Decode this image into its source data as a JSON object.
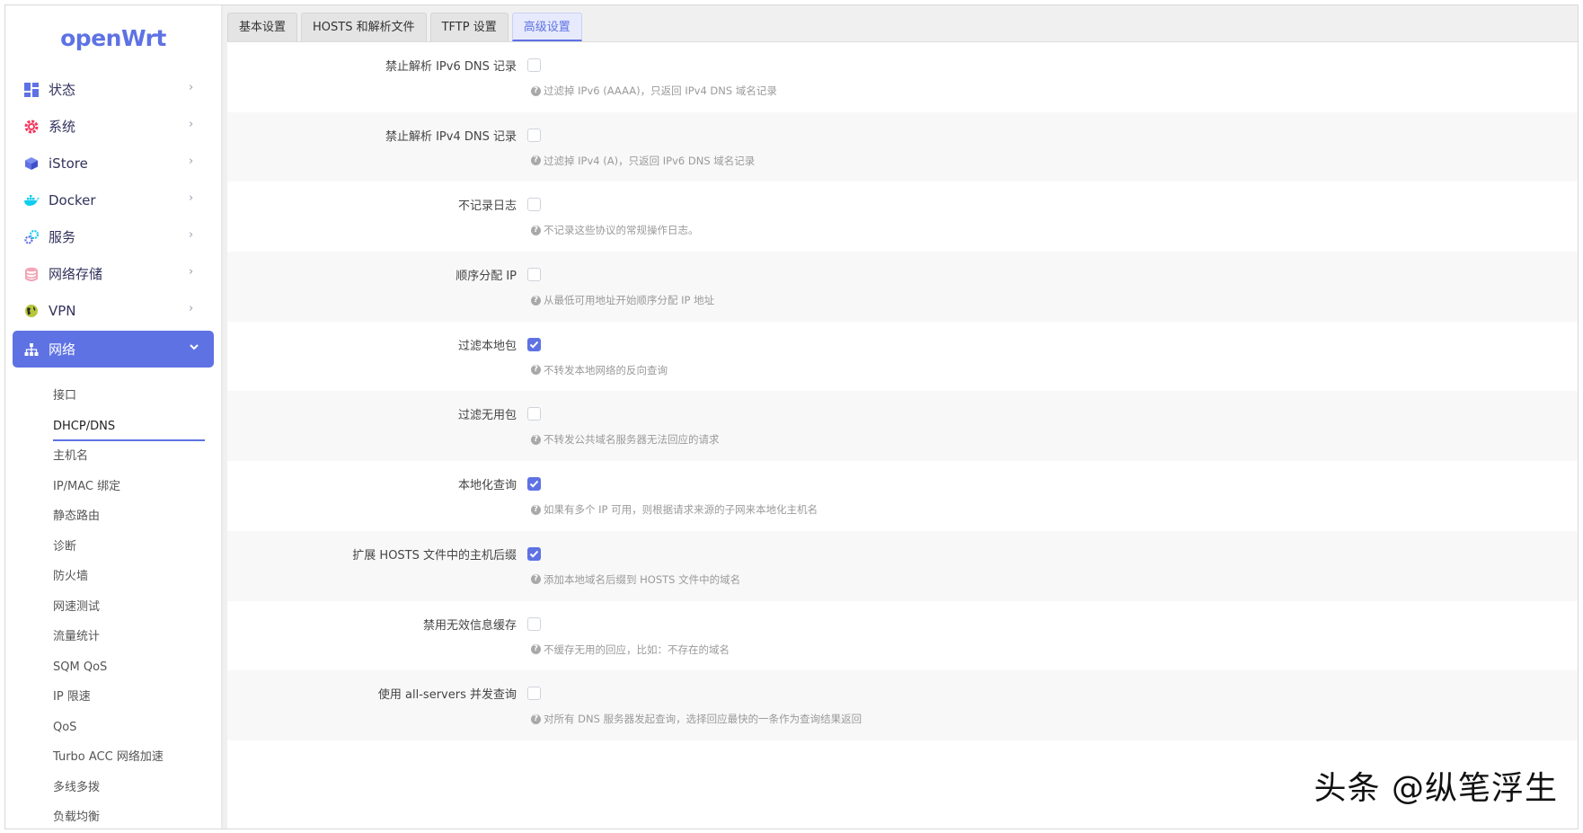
{
  "sidebar": {
    "logo": "openWrt",
    "menu": [
      {
        "label": "状态",
        "icon": "dashboard-icon"
      },
      {
        "label": "系统",
        "icon": "gear-icon"
      },
      {
        "label": "iStore",
        "icon": "cube-icon"
      },
      {
        "label": "Docker",
        "icon": "docker-whale-icon"
      },
      {
        "label": "服务",
        "icon": "services-icon"
      },
      {
        "label": "网络存储",
        "icon": "database-icon"
      },
      {
        "label": "VPN",
        "icon": "globe-icon"
      },
      {
        "label": "网络",
        "icon": "network-tree-icon",
        "expanded": true
      }
    ],
    "submenu": [
      {
        "label": "接口"
      },
      {
        "label": "DHCP/DNS",
        "current": true
      },
      {
        "label": "主机名"
      },
      {
        "label": "IP/MAC 绑定"
      },
      {
        "label": "静态路由"
      },
      {
        "label": "诊断"
      },
      {
        "label": "防火墙"
      },
      {
        "label": "网速测试"
      },
      {
        "label": "流量统计"
      },
      {
        "label": "SQM QoS"
      },
      {
        "label": "IP 限速"
      },
      {
        "label": "QoS"
      },
      {
        "label": "Turbo ACC 网络加速"
      },
      {
        "label": "多线多拨"
      },
      {
        "label": "负载均衡"
      }
    ]
  },
  "tabs": [
    {
      "label": "基本设置"
    },
    {
      "label": "HOSTS 和解析文件"
    },
    {
      "label": "TFTP 设置"
    },
    {
      "label": "高级设置",
      "active": true
    }
  ],
  "options": [
    {
      "label": "禁止解析 IPv6 DNS 记录",
      "checked": false,
      "hint": "过滤掉 IPv6 (AAAA)，只返回 IPv4 DNS 域名记录"
    },
    {
      "label": "禁止解析 IPv4 DNS 记录",
      "checked": false,
      "hint": "过滤掉 IPv4 (A)，只返回 IPv6 DNS 域名记录"
    },
    {
      "label": "不记录日志",
      "checked": false,
      "hint": "不记录这些协议的常规操作日志。"
    },
    {
      "label": "顺序分配 IP",
      "checked": false,
      "hint": "从最低可用地址开始顺序分配 IP 地址"
    },
    {
      "label": "过滤本地包",
      "checked": true,
      "hint": "不转发本地网络的反向查询"
    },
    {
      "label": "过滤无用包",
      "checked": false,
      "hint": "不转发公共域名服务器无法回应的请求"
    },
    {
      "label": "本地化查询",
      "checked": true,
      "hint": "如果有多个 IP 可用，则根据请求来源的子网来本地化主机名"
    },
    {
      "label": "扩展 HOSTS 文件中的主机后缀",
      "checked": true,
      "hint": "添加本地域名后缀到 HOSTS 文件中的域名"
    },
    {
      "label": "禁用无效信息缓存",
      "checked": false,
      "hint": "不缓存无用的回应，比如：不存在的域名"
    },
    {
      "label": "使用 all-servers 并发查询",
      "checked": false,
      "hint": "对所有 DNS 服务器发起查询，选择回应最快的一条作为查询结果返回"
    }
  ],
  "watermark": "头条 @纵笔浮生",
  "colors": {
    "accent": "#5e72e4",
    "hint": "#9a9a9a"
  }
}
